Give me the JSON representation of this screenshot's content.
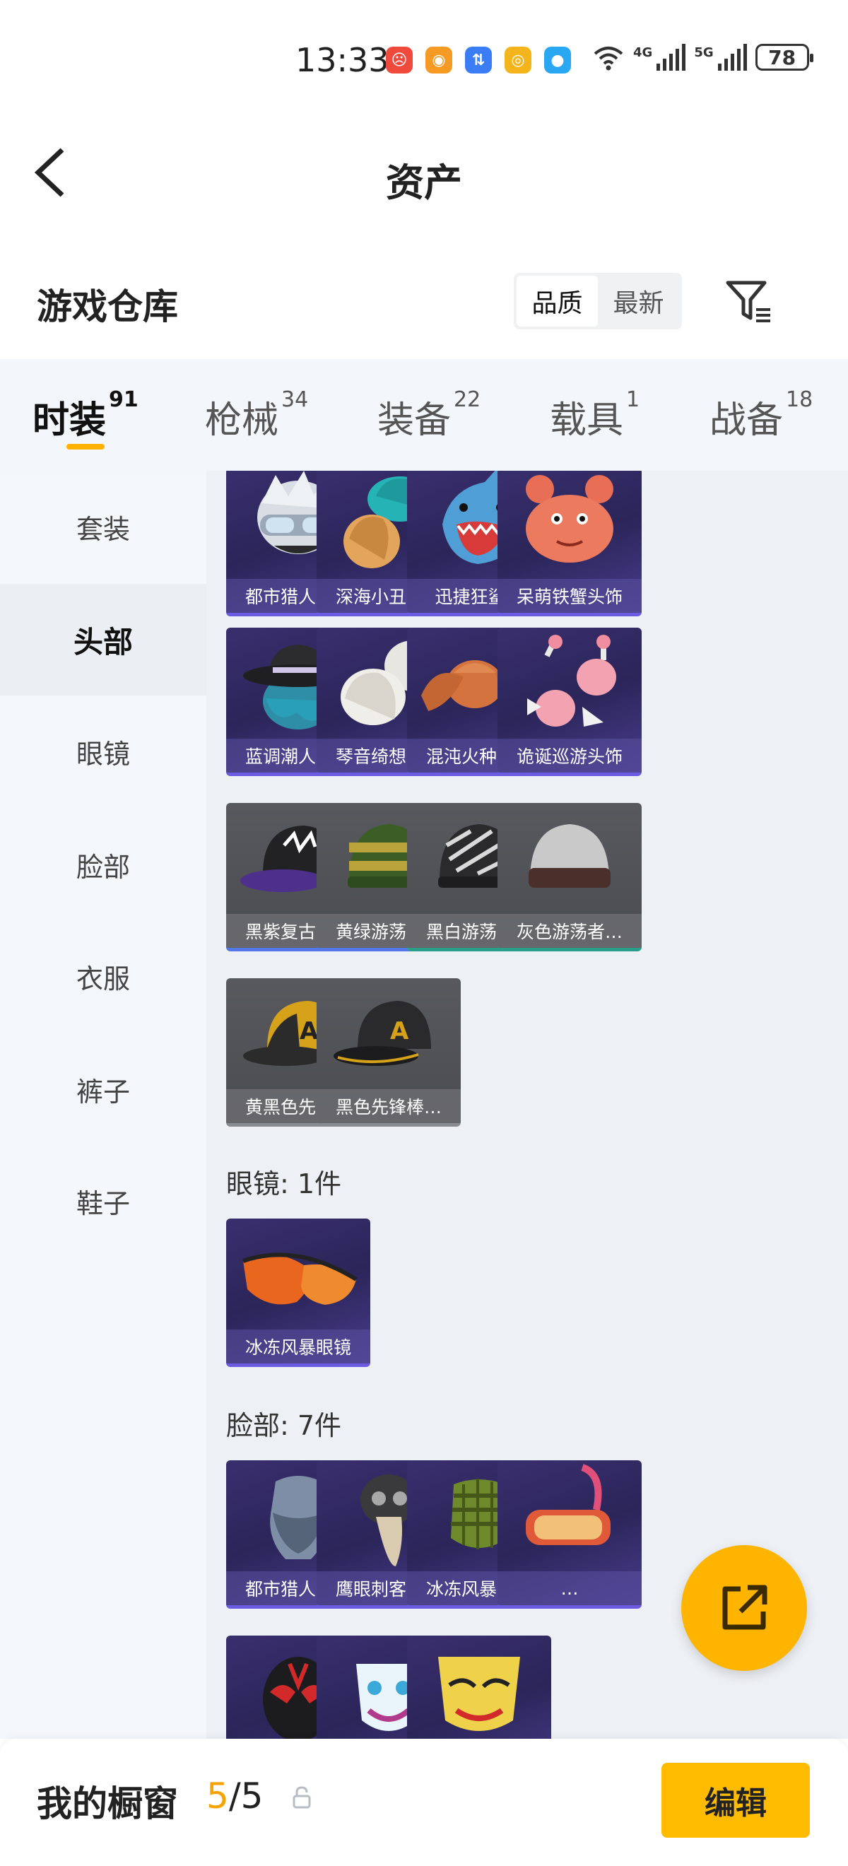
{
  "status": {
    "time": "13:33",
    "net1": "4G",
    "net2": "5G",
    "battery": "78"
  },
  "header": {
    "title": "资产"
  },
  "warehouse": {
    "title": "游戏仓库",
    "sort_options": [
      "品质",
      "最新"
    ],
    "active_sort": "品质"
  },
  "tabs": [
    {
      "label": "时装",
      "count": "91"
    },
    {
      "label": "枪械",
      "count": "34"
    },
    {
      "label": "装备",
      "count": "22"
    },
    {
      "label": "载具",
      "count": "1"
    },
    {
      "label": "战备",
      "count": "18"
    }
  ],
  "sidebar": {
    "items": [
      {
        "label": "套装"
      },
      {
        "label": "头部"
      },
      {
        "label": "眼镜"
      },
      {
        "label": "脸部"
      },
      {
        "label": "衣服"
      },
      {
        "label": "裤子"
      },
      {
        "label": "鞋子"
      }
    ],
    "active": "头部"
  },
  "head_items": [
    {
      "name": "都市猎人头套"
    },
    {
      "name": "深海小丑鱼…"
    },
    {
      "name": "迅捷狂鲨帽"
    },
    {
      "name": "呆萌铁蟹头饰"
    },
    {
      "name": "蓝调潮人帽子"
    },
    {
      "name": "琴音绮想头饰"
    },
    {
      "name": "混沌火种头饰"
    },
    {
      "name": "诡诞巡游头饰"
    },
    {
      "name": "黑紫复古棒…"
    },
    {
      "name": "黄绿游荡者…"
    },
    {
      "name": "黑白游荡者…"
    },
    {
      "name": "灰色游荡者…"
    },
    {
      "name": "黄黑色先锋…"
    },
    {
      "name": "黑色先锋棒…"
    }
  ],
  "glasses_section": {
    "label": "眼镜: 1件",
    "items": [
      {
        "name": "冰冻风暴眼镜"
      }
    ]
  },
  "face_section": {
    "label": "脸部: 7件",
    "items": [
      {
        "name": "都市猎人面罩"
      },
      {
        "name": "鹰眼刺客面罩"
      },
      {
        "name": "冰冻风暴面罩"
      },
      {
        "name": "…"
      }
    ]
  },
  "showcase": {
    "label": "我的橱窗",
    "current": "5",
    "separator": "/",
    "total": "5",
    "edit_label": "编辑"
  }
}
